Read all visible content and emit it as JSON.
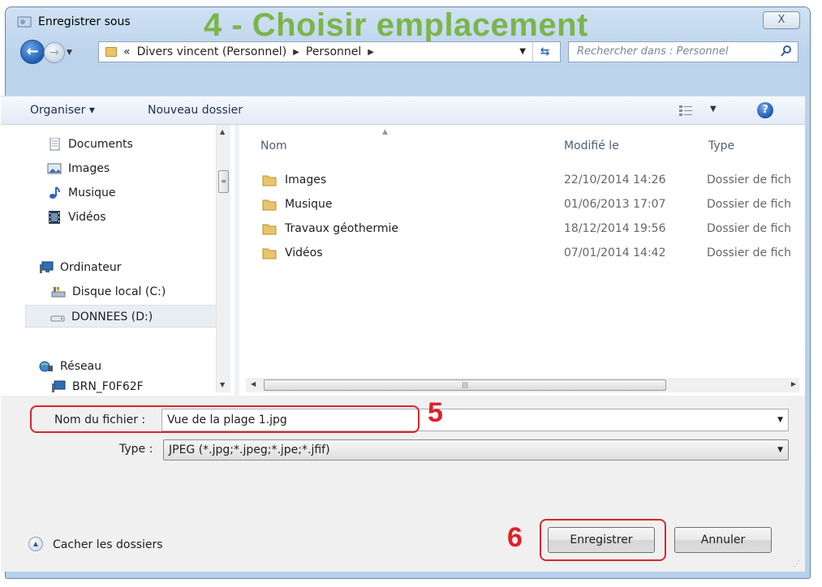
{
  "window": {
    "title": "Enregistrer sous",
    "close_label": "X"
  },
  "annotation": {
    "banner": "4 - Choisir emplacement",
    "step5": "5",
    "step6": "6"
  },
  "address_bar": {
    "overflow": "«",
    "crumbs": [
      "Divers vincent (Personnel)",
      "Personnel"
    ],
    "search_placeholder": "Rechercher dans : Personnel"
  },
  "toolbar": {
    "organize": "Organiser ▾",
    "new_folder": "Nouveau dossier",
    "help": "?"
  },
  "nav_pane": {
    "items": [
      {
        "label": "Documents",
        "icon": "documents-icon"
      },
      {
        "label": "Images",
        "icon": "images-icon"
      },
      {
        "label": "Musique",
        "icon": "music-icon"
      },
      {
        "label": "Vidéos",
        "icon": "videos-icon"
      },
      {
        "label": "Ordinateur",
        "icon": "computer-icon"
      },
      {
        "label": "Disque local (C:)",
        "icon": "local-disk-icon"
      },
      {
        "label": "DONNEES (D:)",
        "icon": "drive-icon",
        "selected": true
      },
      {
        "label": "Réseau",
        "icon": "network-icon"
      },
      {
        "label": "BRN_F0F62F",
        "icon": "network-device-icon"
      }
    ]
  },
  "file_list": {
    "columns": [
      "Nom",
      "Modifié le",
      "Type"
    ],
    "rows": [
      {
        "name": "Images",
        "modified": "22/10/2014 14:26",
        "type": "Dossier de fich"
      },
      {
        "name": "Musique",
        "modified": "01/06/2013 17:07",
        "type": "Dossier de fich"
      },
      {
        "name": "Travaux géothermie",
        "modified": "18/12/2014 19:56",
        "type": "Dossier de fich"
      },
      {
        "name": "Vidéos",
        "modified": "07/01/2014 14:42",
        "type": "Dossier de fich"
      }
    ]
  },
  "save_form": {
    "filename_label": "Nom du fichier :",
    "filename_value": "Vue de la plage 1.jpg",
    "type_label": "Type :",
    "type_value": "JPEG (*.jpg;*.jpeg;*.jpe;*.jfif)"
  },
  "footer": {
    "hide_folders": "Cacher les dossiers",
    "save_button": "Enregistrer",
    "cancel_button": "Annuler"
  },
  "colors": {
    "banner": "#7bb54a",
    "annotation_red": "#e01f26",
    "folder": "#e9c46a"
  }
}
